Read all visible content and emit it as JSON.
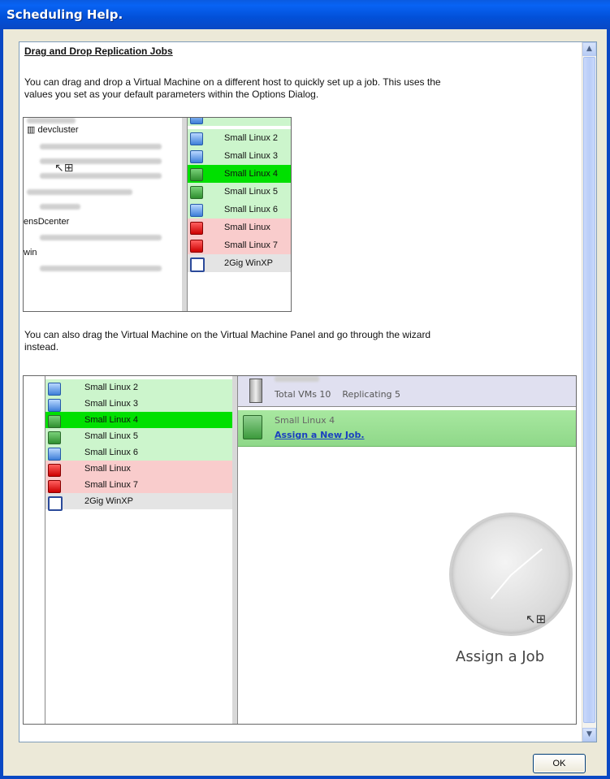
{
  "window": {
    "title": "Scheduling Help."
  },
  "help": {
    "heading": "Drag and Drop Replication Jobs",
    "para1_line1": "You can drag and drop a Virtual Machine on a different host to quickly set up a job.  This uses the",
    "para1_line2": "values you set as your default parameters within the Options Dialog.",
    "para2_line1": "You can also drag the Virtual Machine on the Virtual Machine Panel and go through the wizard",
    "para2_line2": "instead."
  },
  "shot1": {
    "tree": [
      "devcluster",
      "ensDcenter",
      "win"
    ],
    "vms": [
      {
        "label": "Small Linux 2",
        "state": "green",
        "icon": "vm-group-icon"
      },
      {
        "label": "Small Linux 3",
        "state": "green",
        "icon": "vm-group-icon"
      },
      {
        "label": "Small Linux 4",
        "state": "selected",
        "icon": "vm-icon"
      },
      {
        "label": "Small Linux 5",
        "state": "green",
        "icon": "vm-icon"
      },
      {
        "label": "Small Linux 6",
        "state": "green",
        "icon": "vm-group-icon"
      },
      {
        "label": "Small Linux",
        "state": "red",
        "icon": "vm-locked-icon"
      },
      {
        "label": "Small Linux 7",
        "state": "red",
        "icon": "vm-locked-icon"
      },
      {
        "label": "2Gig WinXP",
        "state": "gray",
        "icon": "doc-icon"
      }
    ]
  },
  "shot2": {
    "vms": [
      {
        "label": "Small Linux 2",
        "state": "green"
      },
      {
        "label": "Small Linux 3",
        "state": "green"
      },
      {
        "label": "Small Linux 4",
        "state": "selected"
      },
      {
        "label": "Small Linux 5",
        "state": "green"
      },
      {
        "label": "Small Linux 6",
        "state": "green"
      },
      {
        "label": "Small Linux",
        "state": "red"
      },
      {
        "label": "Small Linux 7",
        "state": "red"
      },
      {
        "label": "2Gig WinXP",
        "state": "gray"
      }
    ],
    "host_info": "Total VMs 10    Replicating 5",
    "selected_vm": "Small Linux 4",
    "assign_link": "Assign a New Job.",
    "assign_text": "Assign a Job"
  },
  "buttons": {
    "ok": "OK"
  },
  "colors": {
    "title_bar": "#0a5ae0",
    "green_row": "#ccf5cc",
    "selected_row": "#00e000",
    "red_row": "#f9cccc"
  }
}
